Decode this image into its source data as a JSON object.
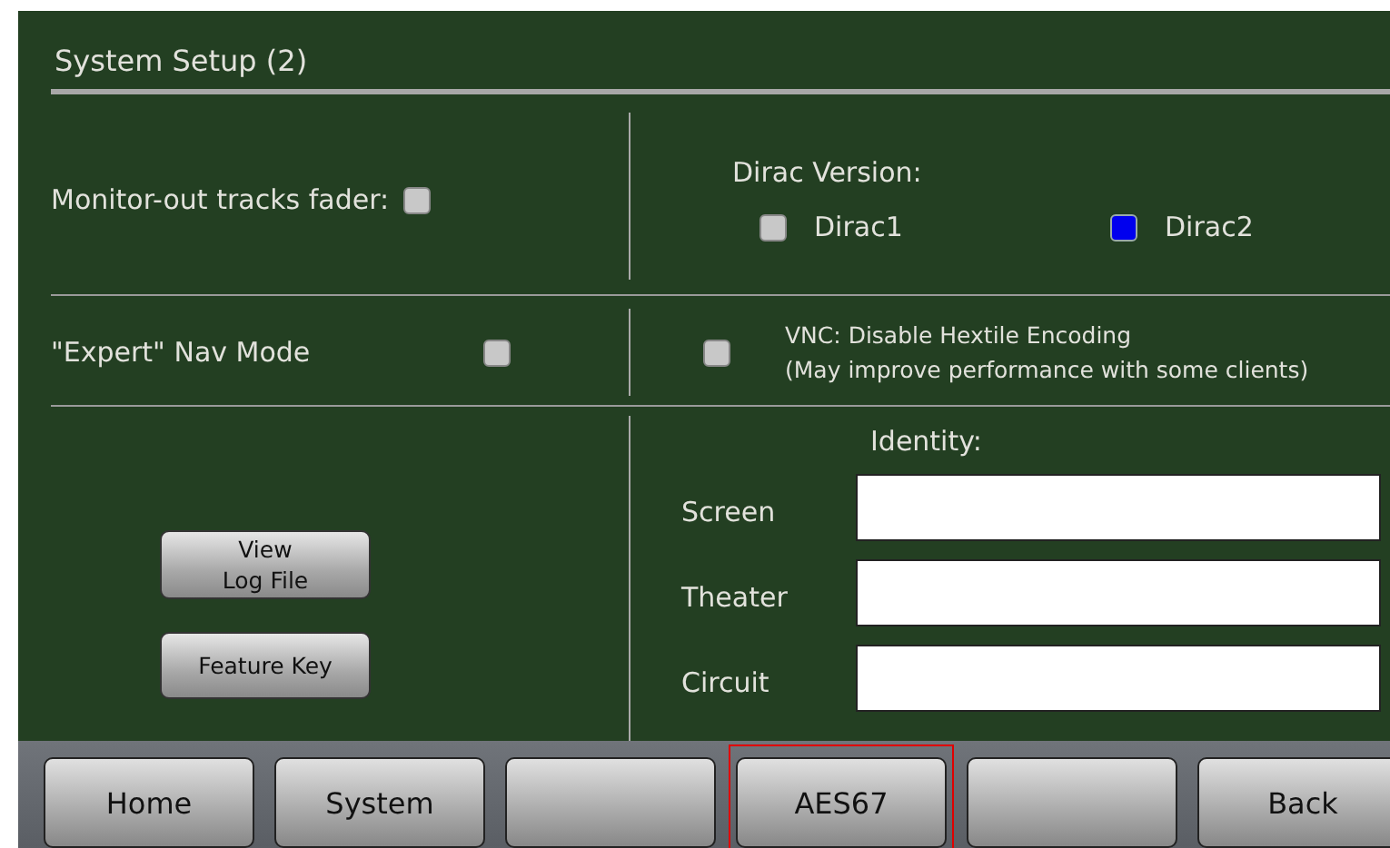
{
  "panel": {
    "title": "System Setup (2)"
  },
  "monitor_fader": {
    "label": "Monitor-out tracks fader:",
    "checked": false
  },
  "dirac": {
    "label": "Dirac Version:",
    "options": [
      {
        "label": "Dirac1",
        "selected": false
      },
      {
        "label": "Dirac2",
        "selected": true
      }
    ]
  },
  "expert_nav": {
    "label": "\"Expert\" Nav Mode",
    "checked": false
  },
  "vnc": {
    "lines": [
      "VNC: Disable Hextile Encoding",
      "(May improve performance with some clients)"
    ],
    "checked": false
  },
  "buttons": [
    [
      "View",
      "Log File"
    ],
    [
      "Feature Key"
    ]
  ],
  "identity": {
    "label": "Identity:",
    "fields": [
      {
        "label": "Screen"
      },
      {
        "label": "Theater"
      },
      {
        "label": "Circuit"
      }
    ]
  },
  "nav_buttons": [
    {
      "label": "Home",
      "highlighted": false
    },
    {
      "label": "System",
      "highlighted": false
    },
    {
      "highlighted": false
    },
    {
      "label": "AES67",
      "highlighted": true
    },
    {
      "highlighted": false
    },
    {
      "label": "Back",
      "highlighted": false
    }
  ]
}
